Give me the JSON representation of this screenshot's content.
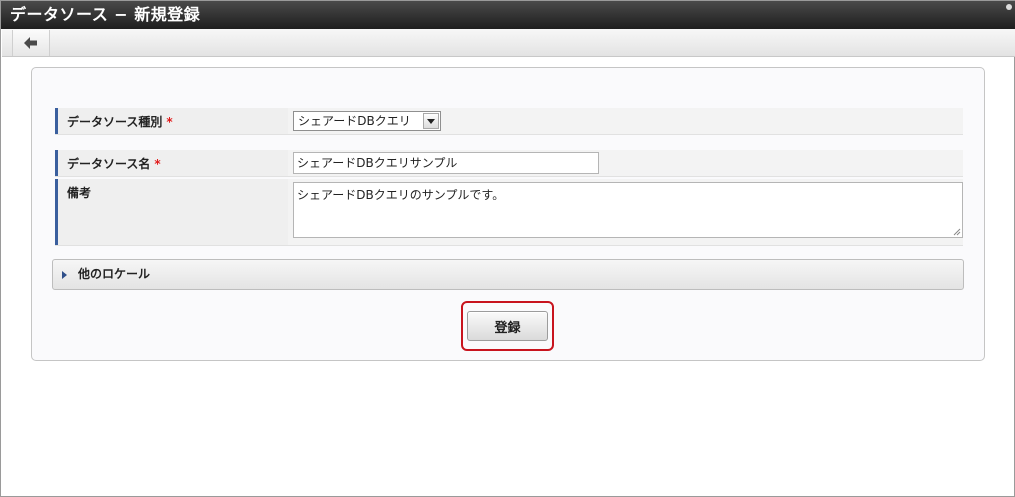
{
  "window": {
    "title": "データソース − 新規登録"
  },
  "toolbar": {
    "back_icon": "arrow-left-icon"
  },
  "form": {
    "datasource_type": {
      "label": "データソース種別",
      "required_mark": "*",
      "selected": "シェアードDBクエリ"
    },
    "datasource_name": {
      "label": "データソース名",
      "required_mark": "*",
      "value": "シェアードDBクエリサンプル"
    },
    "notes": {
      "label": "備考",
      "value": "シェアードDBクエリのサンプルです。"
    }
  },
  "other_locales": {
    "label": "他のロケール"
  },
  "submit": {
    "label": "登録"
  },
  "colors": {
    "title_bar": "#2a2a2a",
    "label_accent": "#3a5f9e",
    "required": "#e21b1b",
    "highlight": "#c8141e"
  }
}
